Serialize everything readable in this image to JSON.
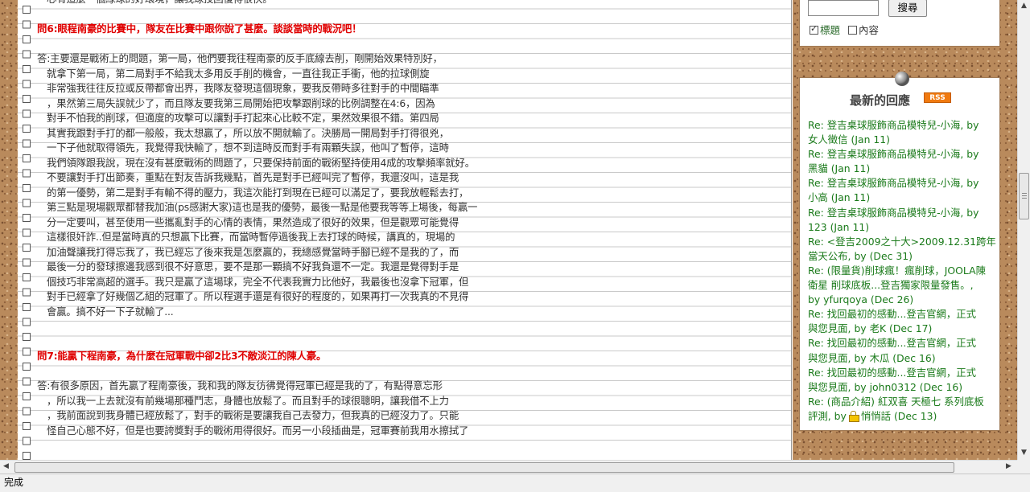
{
  "article": {
    "lines": [
      {
        "text": "心有這麼一個綠球的好環境，讓我球技回復得很快。",
        "kind": "top"
      },
      {
        "text": "",
        "kind": "blank"
      },
      {
        "text": "問6:眼程南豪的比賽中，隊友在比賽中跟你說了甚麼。談談當時的戰況吧！",
        "kind": "q"
      },
      {
        "text": "",
        "kind": "blank"
      },
      {
        "text": "答:主要還是戰術上的問題，第一局，他們要我往程南豪的反手底線去削，剛開始效果特別好，",
        "kind": "a"
      },
      {
        "text": "就拿下第一局，第二局對手不給我太多用反手削的機會，一直往我正手衝，他的拉球側旋",
        "kind": "indent"
      },
      {
        "text": "非常強我往往反拉或反帶都會出界，我隊友發現這個現象，要我反帶時多往對手的中間瞄準",
        "kind": "indent"
      },
      {
        "text": "，果然第三局失誤就少了，而且隊友要我第三局開始把攻擊跟削球的比例調整在4:6，因為",
        "kind": "indent"
      },
      {
        "text": "對手不怕我的削球，但適度的攻擊可以讓對手打起來心比較不定，果然效果很不錯。第四局",
        "kind": "indent"
      },
      {
        "text": "其實我跟對手打的都一般般，我太想贏了，所以放不開就輸了。決勝局一開局對手打得很兇，",
        "kind": "indent"
      },
      {
        "text": "一下子他就取得領先，我覺得我快輸了，想不到這時反而對手有兩顆失誤，他叫了暫停，這時",
        "kind": "indent"
      },
      {
        "text": "我們領隊跟我說，現在沒有甚麼戰術的問題了，只要保持前面的戰術堅持使用4成的攻擊頻率就好。",
        "kind": "indent"
      },
      {
        "text": "不要讓對手打出節奏，重點在對友告訴我幾點，首先是對手已經叫完了暫停，我還沒叫，這是我",
        "kind": "indent"
      },
      {
        "text": "的第一優勢，第二是對手有輸不得的壓力，我這次能打到現在已經可以滿足了，要我放輕鬆去打，",
        "kind": "indent"
      },
      {
        "text": "第三點是現場觀眾都替我加油(ps感謝大家)這也是我的優勢，最後一點是他要我等等上場後，每贏一",
        "kind": "indent"
      },
      {
        "text": "分一定要叫，甚至使用一些攜亂對手的心情的表情，果然造成了很好的效果，但是觀眾可能覺得",
        "kind": "indent"
      },
      {
        "text": "這樣很奸詐..但是當時真的只想贏下比賽，而當時暫停過後我上去打球的時候，講真的，現場的",
        "kind": "indent"
      },
      {
        "text": "加油聲讓我打得忘我了，我已經忘了後來我是怎麼贏的，我總感覺當時手腳已經不是我的了，而",
        "kind": "indent"
      },
      {
        "text": "最後一分的發球擦邊我感到很不好意思，要不是那一顆搞不好我負還不一定。我還是覺得對手是",
        "kind": "indent"
      },
      {
        "text": "個技巧非常高超的選手。我只是贏了這場球，完全不代表我實力比他好，我最後也沒拿下冠軍，但",
        "kind": "indent"
      },
      {
        "text": "對手已經拿了好幾個乙組的冠軍了。所以程選手還是有很好的程度的，如果再打一次我真的不見得",
        "kind": "indent"
      },
      {
        "text": "會贏。搞不好一下子就輸了...",
        "kind": "indent"
      },
      {
        "text": "",
        "kind": "blank"
      },
      {
        "text": "",
        "kind": "blank"
      },
      {
        "text": "問7:能贏下程南豪，為什麼在冠軍戰中卻2比3不敵淡江的陳人豪。",
        "kind": "q"
      },
      {
        "text": "",
        "kind": "blank"
      },
      {
        "text": "答:有很多原因，首先贏了程南豪後，我和我的隊友彷彿覺得冠軍已經是我的了，有點得意忘形",
        "kind": "a"
      },
      {
        "text": "，所以我一上去就沒有前幾場那種鬥志，身體也放鬆了。而且對手的球很聰明，讓我借不上力",
        "kind": "indent"
      },
      {
        "text": "，我前面說到我身體已經放鬆了，對手的戰術是要讓我自己去發力，但我真的已經沒力了。只能",
        "kind": "indent"
      },
      {
        "text": "怪自己心態不好，但是也要誇獎對手的戰術用得很好。而另一小段插曲是，冠軍賽前我用水擦拭了",
        "kind": "indent"
      }
    ]
  },
  "sidebar": {
    "search": {
      "button_label": "搜尋",
      "input_value": "",
      "opt_title_label": "標題",
      "opt_title_checked": true,
      "opt_content_label": "內容",
      "opt_content_checked": false
    },
    "recent": {
      "title": "最新的回應",
      "rss_label": "RSS",
      "lines": [
        {
          "text": "Re: 登吉桌球服飾商品模特兒-小海, by"
        },
        {
          "text": "女人徵信 (Jan 11)"
        },
        {
          "text": "Re: 登吉桌球服飾商品模特兒-小海, by"
        },
        {
          "text": "黑貓 (Jan 11)"
        },
        {
          "text": "Re: 登吉桌球服飾商品模特兒-小海, by"
        },
        {
          "text": "小高 (Jan 11)"
        },
        {
          "text": "Re: 登吉桌球服飾商品模特兒-小海, by"
        },
        {
          "text": "123 (Jan 11)"
        },
        {
          "text": "Re: <登吉2009之十大>2009.12.31跨年"
        },
        {
          "text": "當天公布, by (Dec 31)"
        },
        {
          "text": "Re: (限量貨)削球瘋！瘋削球，JOOLA陳"
        },
        {
          "text": "衛星 削球底板...登吉獨家限量發售。,"
        },
        {
          "text": "by yfurqoya (Dec 26)"
        },
        {
          "text": "Re: 找回最初的感動...登吉官網，正式"
        },
        {
          "text": "與您見面, by 老K (Dec 17)"
        },
        {
          "text": "Re: 找回最初的感動...登吉官網，正式"
        },
        {
          "text": "與您見面, by 木瓜 (Dec 16)"
        },
        {
          "text": "Re: 找回最初的感動...登吉官網，正式"
        },
        {
          "text": "與您見面, by john0312 (Dec 16)"
        },
        {
          "text": "Re: (商品介紹) 紅双喜 天極七 系列底板"
        },
        {
          "text": "評測, by",
          "lock": true,
          "after": "悄悄話 (Dec 13)"
        }
      ]
    }
  },
  "status": {
    "text": "完成"
  },
  "icons": {
    "pin": "pushpin-icon",
    "lock": "lock-icon",
    "rss": "rss-badge"
  }
}
